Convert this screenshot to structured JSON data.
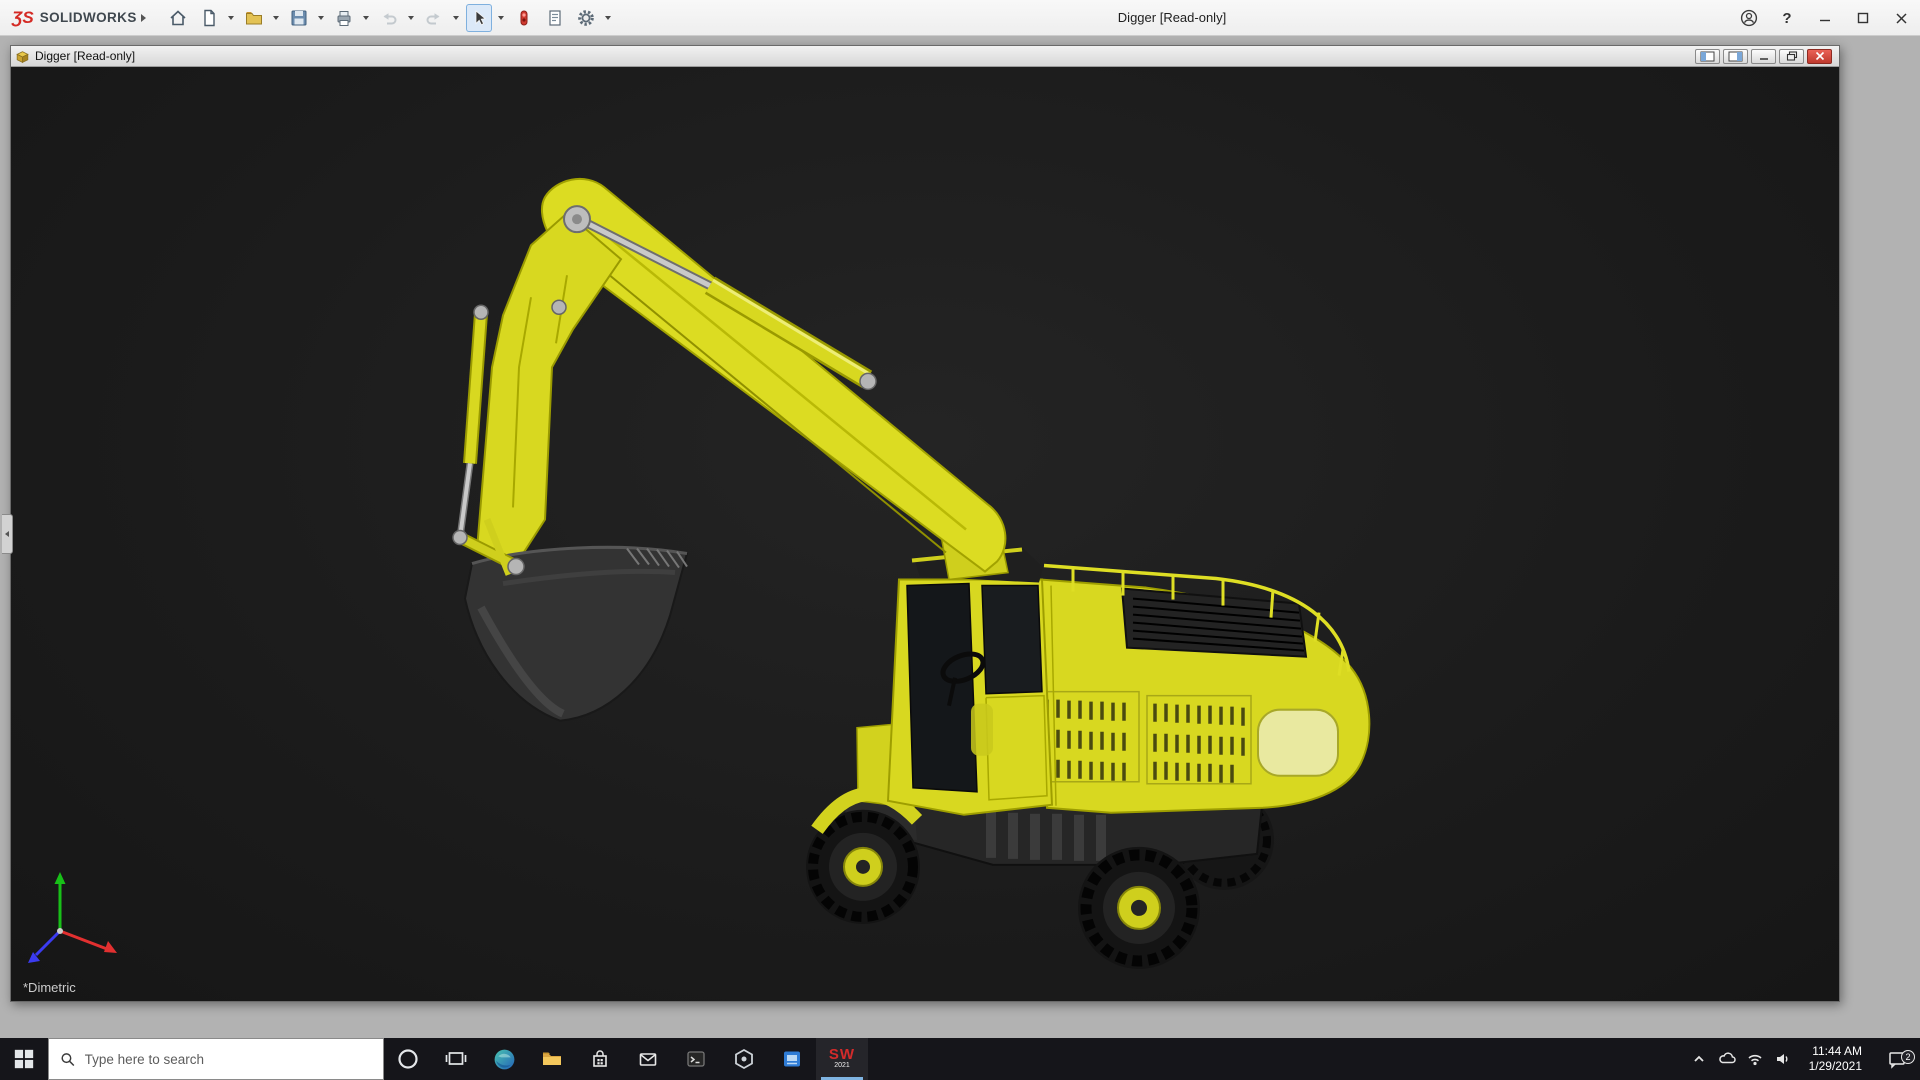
{
  "app": {
    "brand": "SOLIDWORKS",
    "logo_glyph": "ƷS",
    "window_title": "Digger [Read-only]",
    "help_glyph": "?",
    "toolbar_icons": [
      "home",
      "new-document",
      "open",
      "save",
      "print",
      "undo",
      "redo",
      "select-cursor",
      "rebuild",
      "file-properties",
      "options-gear"
    ],
    "titlebar_controls": [
      "account",
      "help",
      "minimize",
      "maximize",
      "close"
    ]
  },
  "document_window": {
    "title": "Digger [Read-only]",
    "controls": [
      "pane-left",
      "pane-right",
      "minimize",
      "restore",
      "close"
    ],
    "viewport": {
      "model": "wheeled-excavator",
      "view_orientation": "*Dimetric",
      "triad_axes": [
        "x",
        "y",
        "z"
      ]
    }
  },
  "taskbar": {
    "search_placeholder": "Type here to search",
    "pinned_icons": [
      "start",
      "cortana",
      "task-view",
      "edge",
      "file-explorer",
      "store",
      "mail",
      "terminal",
      "hexagon-app",
      "blue-app",
      "solidworks"
    ],
    "solidworks_badge": {
      "label": "SW",
      "year": "2021"
    },
    "tray_icons": [
      "hidden-icons",
      "onedrive",
      "network",
      "volume"
    ],
    "clock": {
      "time": "11:44 AM",
      "date": "1/29/2021"
    },
    "action_center_badge": "2"
  },
  "colors": {
    "excavator_yellow": "#d8d820",
    "viewport_background": "#1b1b1b",
    "taskbar_background": "#15151a",
    "document_close_red": "#bf392d",
    "brand_red": "#d42a24",
    "active_underline_blue": "#7fb4e2"
  }
}
